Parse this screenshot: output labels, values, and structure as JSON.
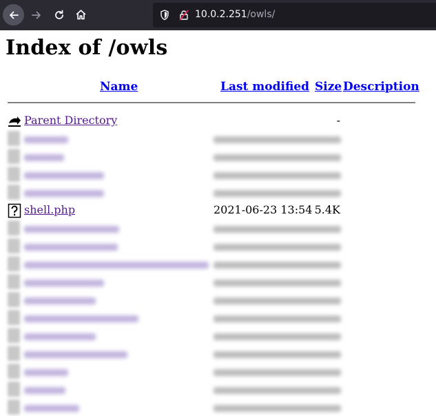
{
  "browser": {
    "url_host": "10.0.2.251",
    "url_path": "/owls/"
  },
  "page": {
    "title": "Index of /owls",
    "headers": {
      "name": "Name",
      "last_modified": "Last modified",
      "size": "Size",
      "description": "Description"
    },
    "parent_row": {
      "name": "Parent Directory",
      "size": "-"
    },
    "visible_row": {
      "name": "shell.php",
      "last_modified": "2021-06-23 13:54",
      "size": "5.4K"
    },
    "redacted_rows_before": 4,
    "redacted_rows_after": 11
  }
}
